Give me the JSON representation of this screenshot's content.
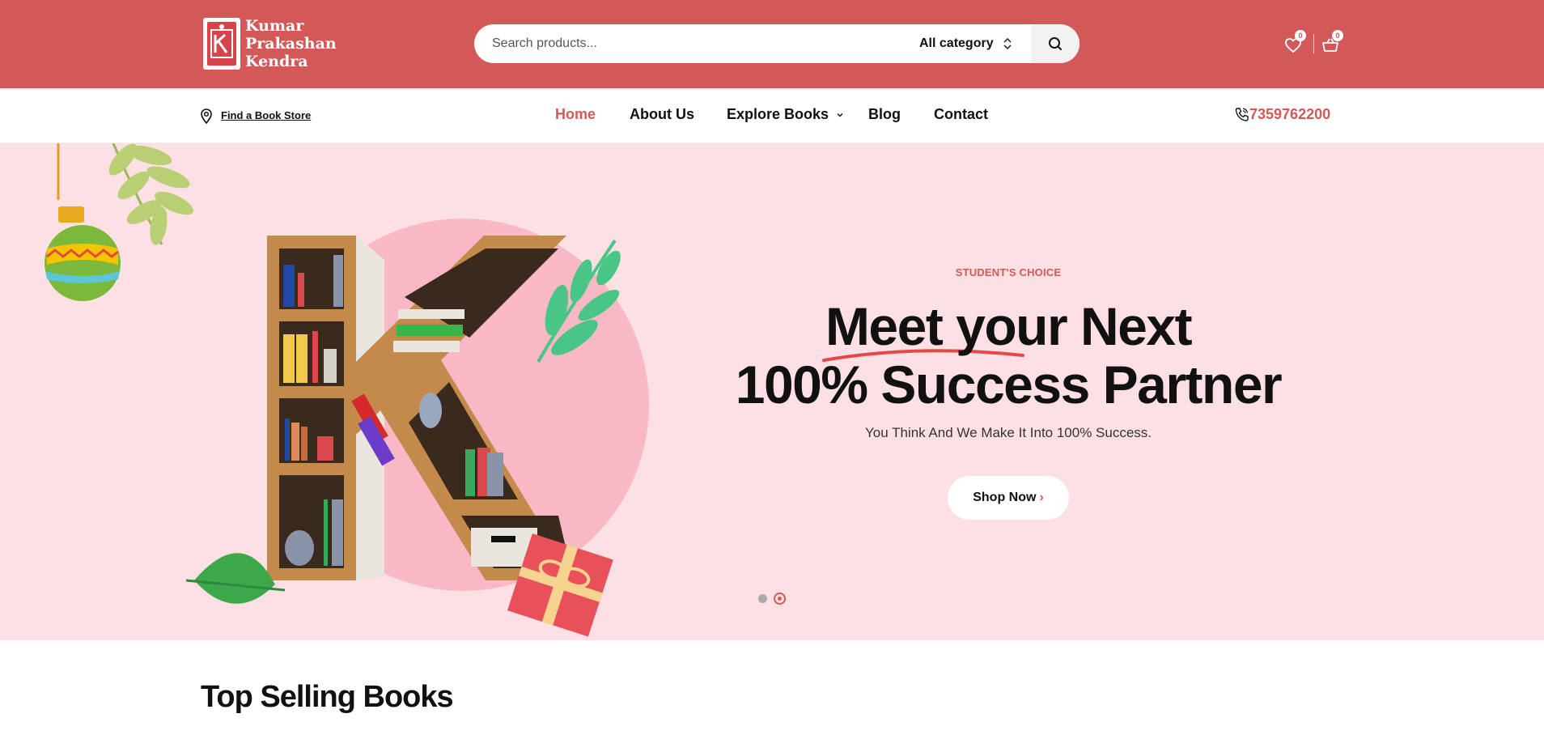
{
  "header": {
    "brand_lines": [
      "Kumar",
      "Prakashan",
      "Kendra"
    ],
    "search_placeholder": "Search products...",
    "category_label": "All category",
    "wishlist_count": "0",
    "cart_count": "0",
    "bg_color": "#d35858"
  },
  "nav": {
    "store_link": "Find a Book Store",
    "items": [
      {
        "label": "Home",
        "active": true
      },
      {
        "label": "About Us"
      },
      {
        "label": "Explore Books"
      },
      {
        "label": "Blog"
      },
      {
        "label": "Contact"
      }
    ],
    "phone": "7359762200",
    "accent_color": "#d35858"
  },
  "hero": {
    "eyebrow": "STUDENT'S CHOICE",
    "headline_line1": "Meet your Next",
    "headline_line2": "100% Success Partner",
    "subtext": "You Think And We Make It Into 100% Success.",
    "cta_label": "Shop Now",
    "slides_total": 2,
    "active_slide": 2,
    "bg_color": "#fde0e4"
  },
  "sections": {
    "top_selling_title": "Top Selling Books"
  }
}
